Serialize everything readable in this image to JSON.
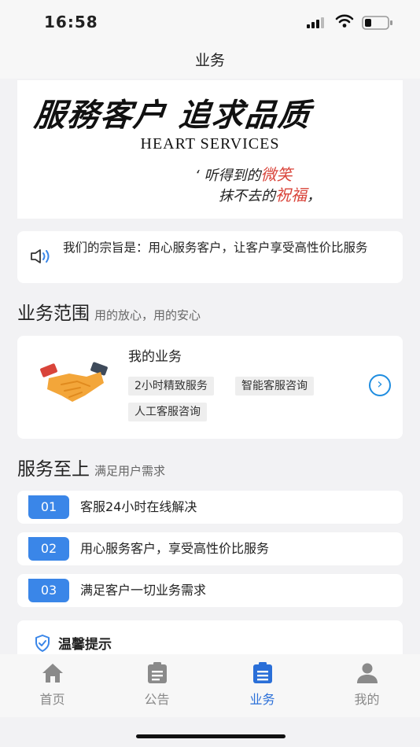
{
  "status": {
    "time": "16:58"
  },
  "nav": {
    "title": "业务"
  },
  "banner": {
    "calligraphy": "服務客户 追求品质",
    "english": "HEART SERVICES",
    "quote_line1_a": "‘ 听得到的",
    "quote_line1_b": "微笑",
    "quote_line2_a": "抹不去的",
    "quote_line2_b": "祝福",
    "quote_line2_c": "，"
  },
  "notice": {
    "text": "我们的宗旨是：用心服务客户，让客户享受高性价比服务"
  },
  "scope": {
    "title": "业务范围",
    "subtitle": "用的放心，用的安心"
  },
  "business": {
    "title": "我的业务",
    "tags": [
      "2小时精致服务",
      "智能客服咨询",
      "人工客服咨询"
    ]
  },
  "service": {
    "title": "服务至上",
    "subtitle": "满足用户需求",
    "items": [
      {
        "num": "01",
        "text": "客服24小时在线解决"
      },
      {
        "num": "02",
        "text": "用心服务客户，享受高性价比服务"
      },
      {
        "num": "03",
        "text": "满足客户一切业务需求"
      }
    ]
  },
  "tip": {
    "title": "温馨提示"
  },
  "tabs": [
    {
      "label": "首页",
      "icon": "home-icon"
    },
    {
      "label": "公告",
      "icon": "clipboard-icon"
    },
    {
      "label": "业务",
      "icon": "list-doc-icon",
      "active": true
    },
    {
      "label": "我的",
      "icon": "user-icon"
    }
  ],
  "colors": {
    "accent": "#2a6fd8",
    "badge": "#3a86e8",
    "highlight_red": "#d9443a"
  }
}
